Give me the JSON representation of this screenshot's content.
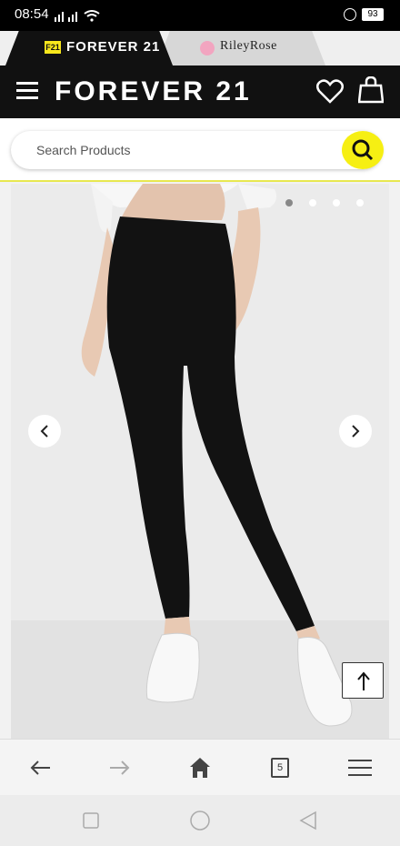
{
  "status_bar": {
    "time": "08:54",
    "battery": "93"
  },
  "brand_tabs": [
    {
      "label": "FOREVER 21",
      "logo_text": "F21",
      "active": true
    },
    {
      "label": "RileyRose",
      "active": false
    }
  ],
  "header": {
    "brand": "FOREVER 21"
  },
  "search": {
    "placeholder": "Search Products"
  },
  "gallery": {
    "image_count": 4,
    "active_index": 0
  },
  "browser_bar": {
    "tab_count": "5"
  },
  "colors": {
    "accent_yellow": "#f6ef13",
    "header_bg": "#111111"
  }
}
